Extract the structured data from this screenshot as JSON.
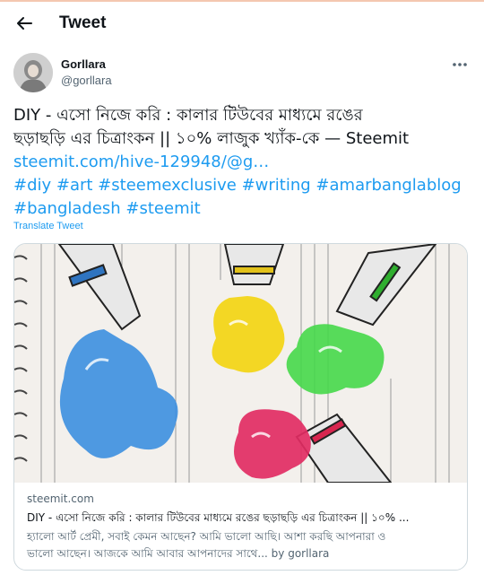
{
  "header": {
    "title": "Tweet"
  },
  "author": {
    "name": "Gorllara",
    "handle": "@gorllara"
  },
  "tweet": {
    "line1": "DIY - এসো নিজে করি : কালার টিউবের মাধ্যমে রঙের",
    "line2": "ছড়াছড়ি এর চিত্রাংকন || ১০% লাজুক খ্যাঁক-কে — Steemit",
    "url": "steemit.com/hive-129948/@g…",
    "hashtags_line1": "#diy #art #steemexclusive #writing #amarbanglablog",
    "hashtags_line2": "#bangladesh #steemit",
    "translate": "Translate Tweet"
  },
  "card": {
    "domain": "steemit.com",
    "title": "DIY - এসো নিজে করি : কালার টিউবের মাধ্যমে রঙের ছড়াছড়ি এর চিত্রাংকন || ১০% ...",
    "desc_line1": "হ্যালো আর্ট প্রেমী, সবাই কেমন আছেন? আমি ভালো আছি। আশা করছি আপনারা ও",
    "desc_line2": "ভালো আছেন। আজকে আমি আবার আপনাদের সাথে... by gorllara"
  },
  "colors": {
    "link": "#1d9bf0",
    "text": "#0f1419",
    "muted": "#536471",
    "border": "#cfd9de"
  },
  "icons": [
    "back-arrow-icon",
    "more-icon"
  ]
}
